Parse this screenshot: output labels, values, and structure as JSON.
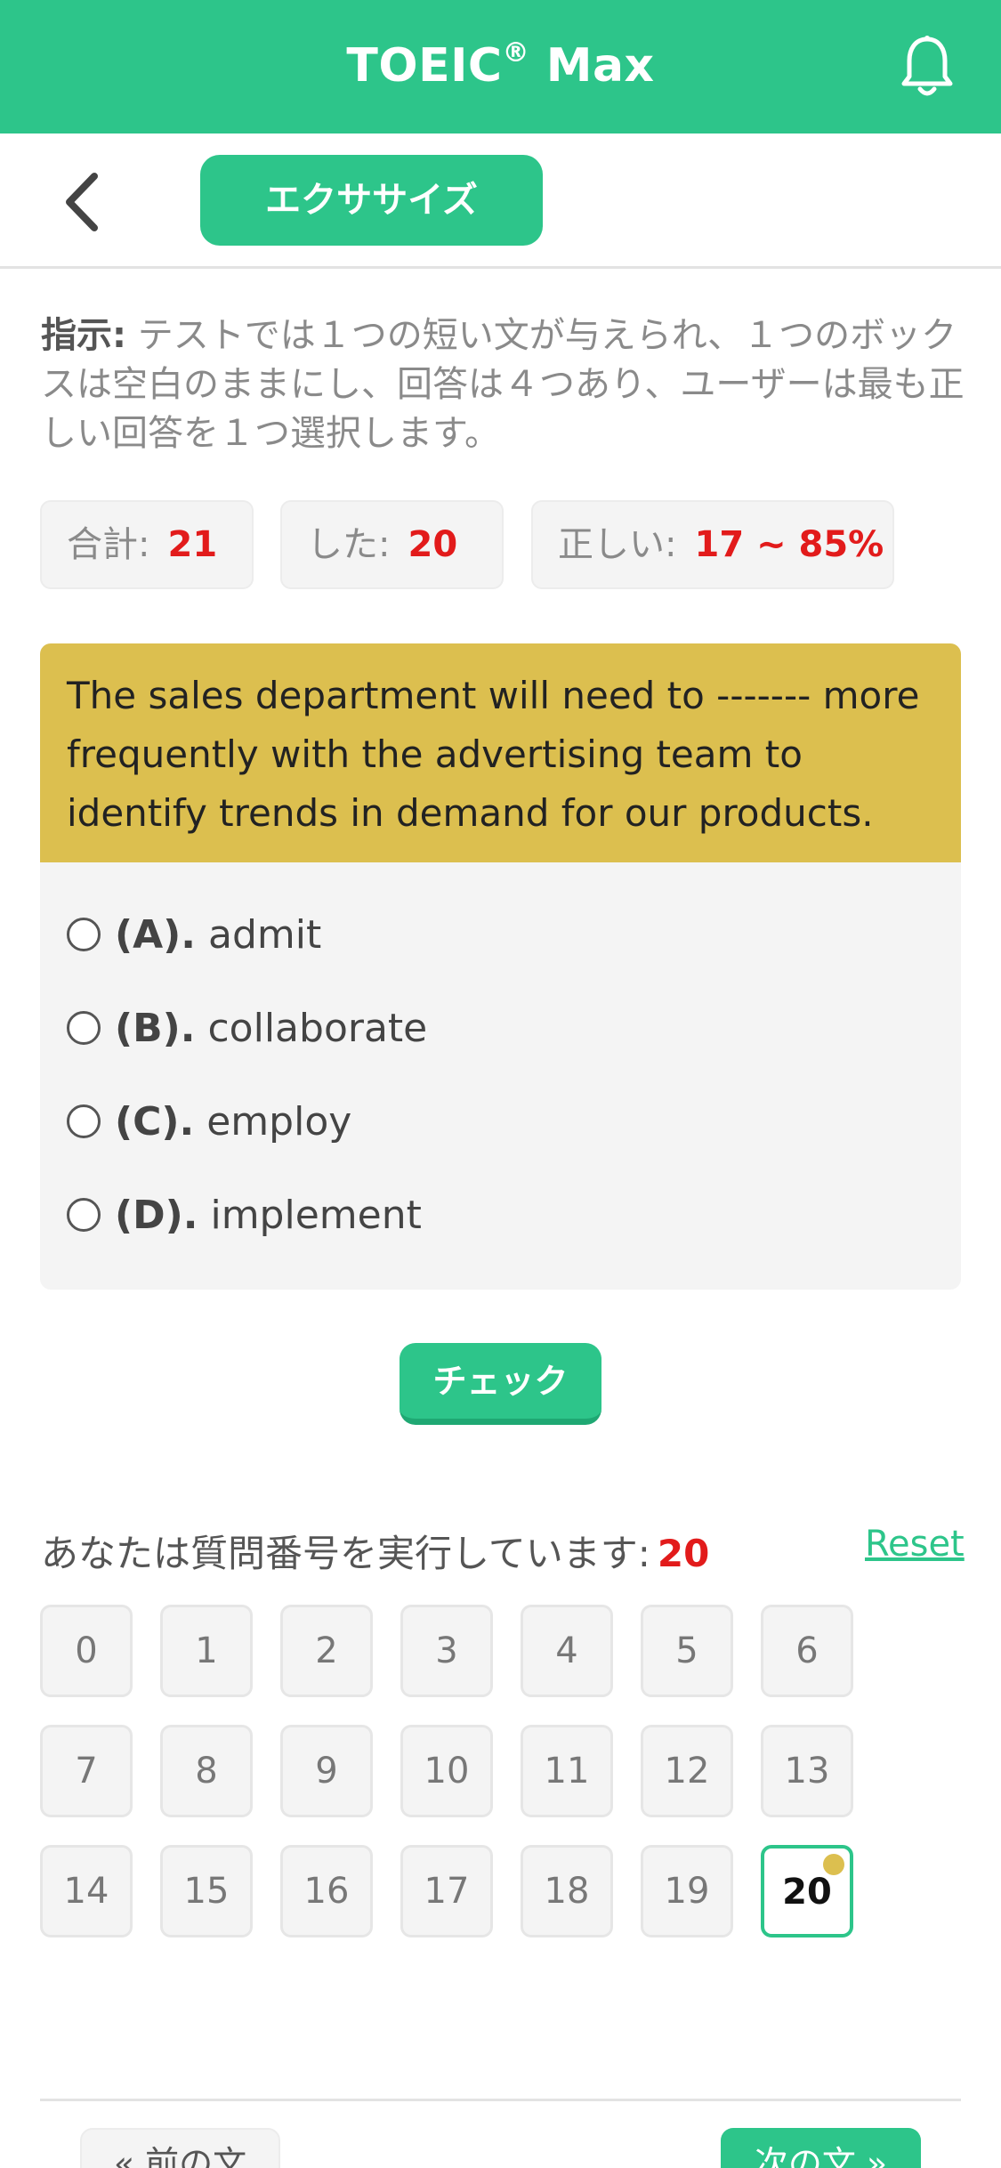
{
  "header": {
    "title_main": "TOEIC",
    "title_reg": "®",
    "title_suffix": " Max"
  },
  "subbar": {
    "tab_label": "エクササイズ"
  },
  "instruction": {
    "label": "指示:",
    "text": " テストでは１つの短い文が与えられ、１つのボックスは空白のままにし、回答は４つあり、ユーザーは最も正しい回答を１つ選択します。"
  },
  "stats": {
    "total_label": "合計:",
    "total_value": "21",
    "done_label": "した:",
    "done_value": "20",
    "correct_label": "正しい:",
    "correct_value": "17 ~ 85%"
  },
  "question": {
    "text": "The sales department will need to ------- more frequently with the advertising team to identify trends in demand for our products.",
    "options": [
      {
        "letter": "(A).",
        "text": "admit"
      },
      {
        "letter": "(B).",
        "text": "collaborate"
      },
      {
        "letter": "(C).",
        "text": "employ"
      },
      {
        "letter": "(D).",
        "text": "implement"
      }
    ]
  },
  "check_label": "チェック",
  "progress": {
    "running_label": "あなたは質問番号を実行しています:",
    "current": "20",
    "reset_label": "Reset",
    "numbers": [
      "0",
      "1",
      "2",
      "3",
      "4",
      "5",
      "6",
      "7",
      "8",
      "9",
      "10",
      "11",
      "12",
      "13",
      "14",
      "15",
      "16",
      "17",
      "18",
      "19",
      "20"
    ],
    "active_index": 20
  },
  "nav": {
    "prev_label": "« 前の文",
    "next_label": "次の文 »"
  },
  "colors": {
    "brand_green": "#2dc58a",
    "question_yellow": "#dcbf4f",
    "stat_red": "#e21b1b"
  },
  "icons": {
    "bell": "bell-icon",
    "back": "chevron-left-icon"
  }
}
